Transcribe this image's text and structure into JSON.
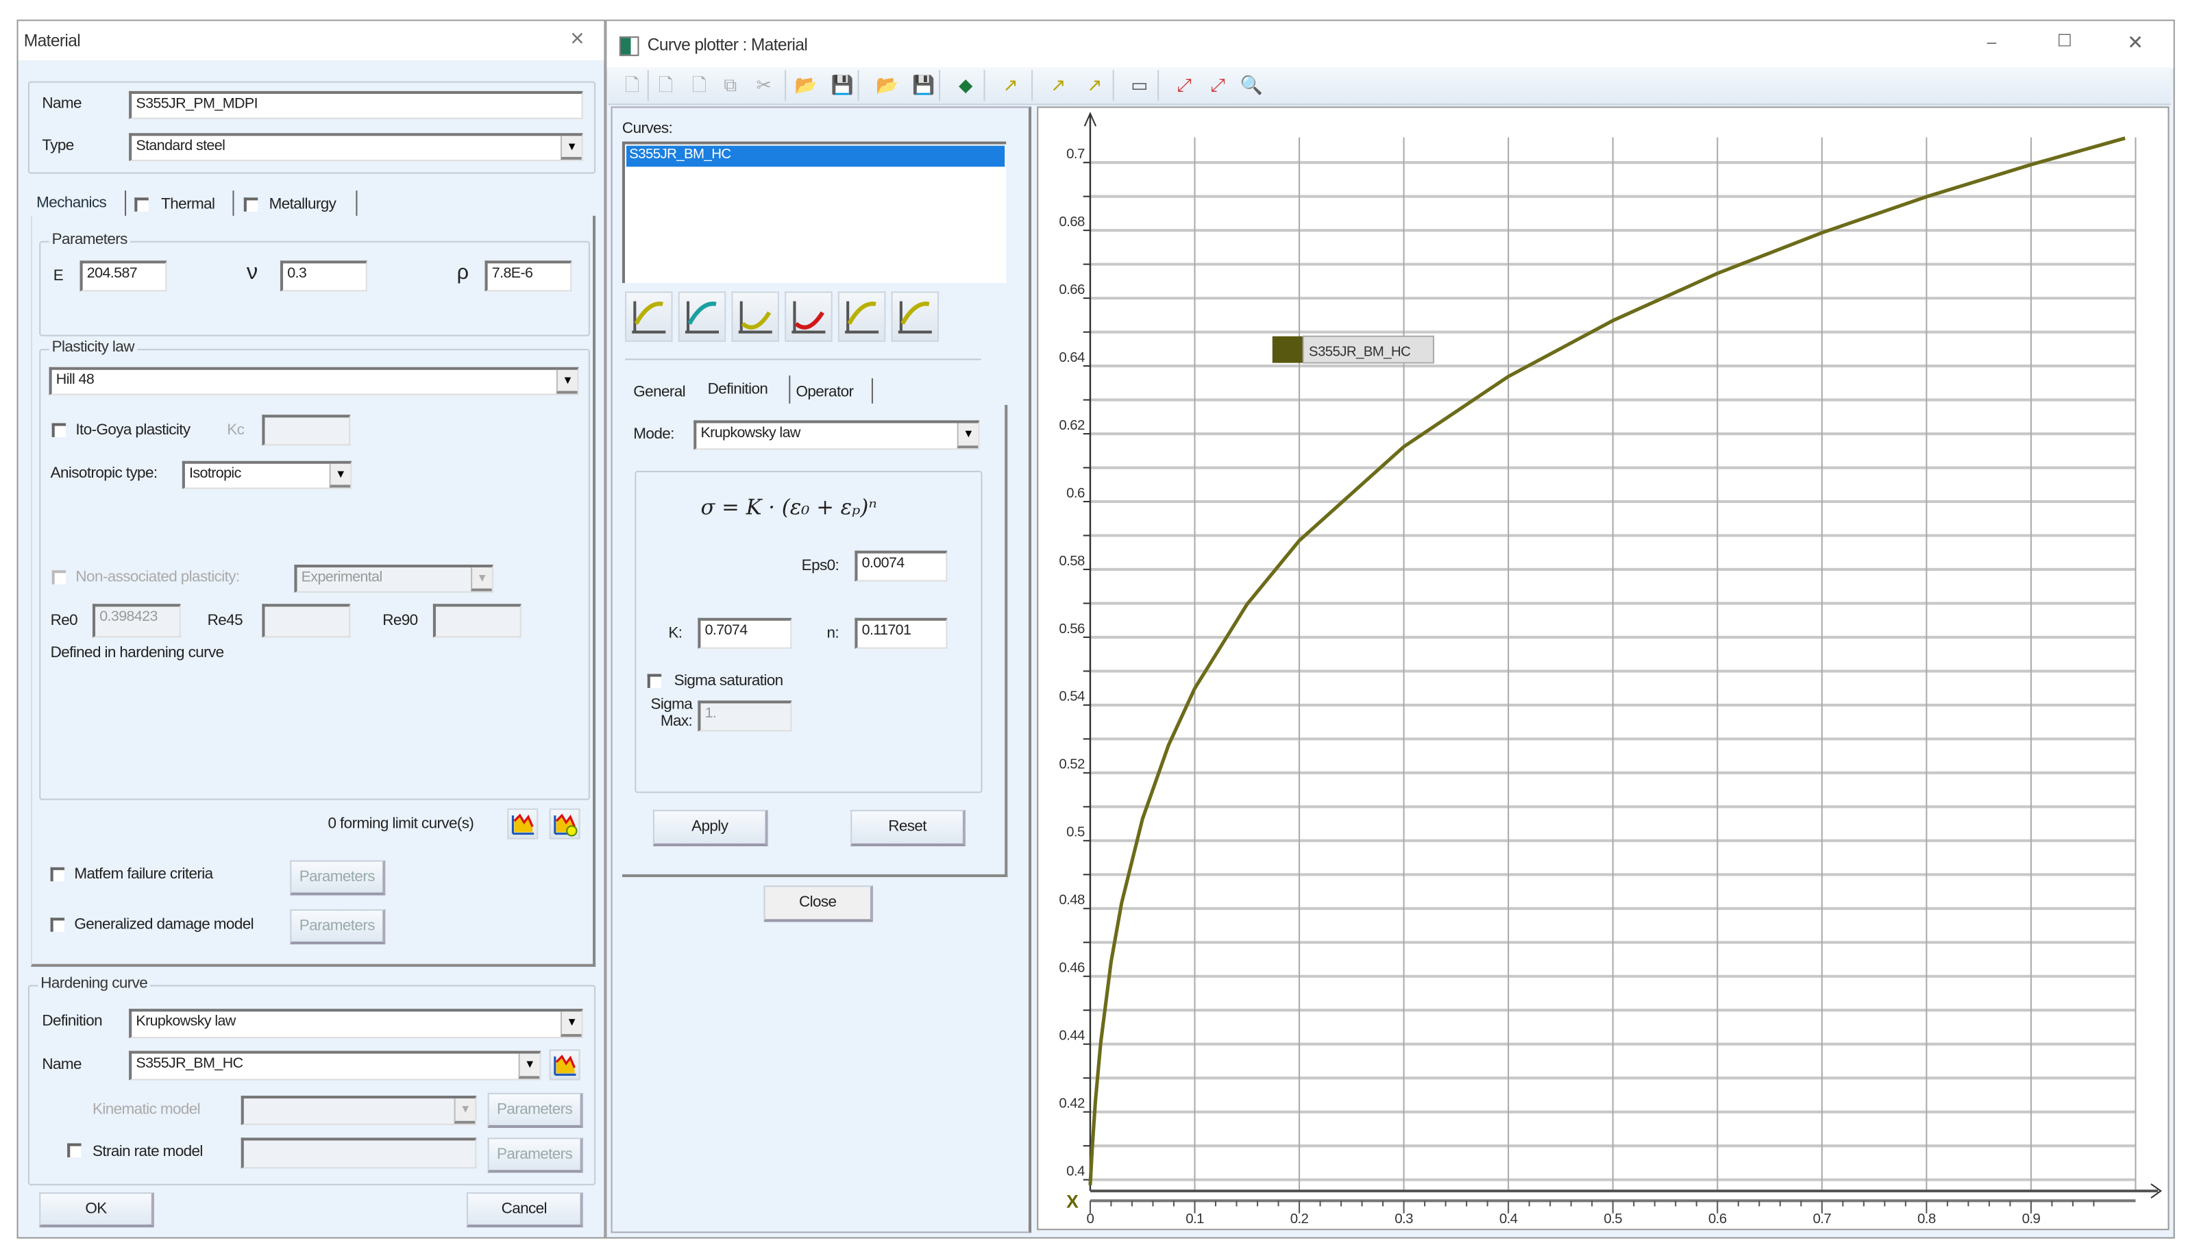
{
  "material": {
    "title": "Material",
    "close_icon": "×",
    "name_label": "Name",
    "name_value": "S355JR_PM_MDPI",
    "type_label": "Type",
    "type_value": "Standard steel",
    "tabs": [
      "Mechanics",
      "Thermal",
      "Metallurgy"
    ],
    "parameters": {
      "legend": "Parameters",
      "e_label": "E",
      "e_value": "204.587",
      "nu_label": "ν",
      "nu_value": "0.3",
      "rho_label": "ρ",
      "rho_value": "7.8E-6"
    },
    "plasticity": {
      "legend": "Plasticity law",
      "law_value": "Hill 48",
      "ito_goya_label": "Ito-Goya plasticity",
      "kc_label": "Kc",
      "anisotropic_label": "Anisotropic type:",
      "anisotropic_value": "Isotropic",
      "non_assoc_label": "Non-associated plasticity:",
      "non_assoc_value": "Experimental",
      "re0_label": "Re0",
      "re0_value": "0.398423",
      "re45_label": "Re45",
      "re90_label": "Re90",
      "defined_note": "Defined in hardening curve"
    },
    "forming_limit_label": "0 forming limit curve(s)",
    "matfem_label": "Matfem failure criteria",
    "damage_label": "Generalized damage model",
    "parameters_button": "Parameters",
    "hardening": {
      "legend": "Hardening curve",
      "definition_label": "Definition",
      "definition_value": "Krupkowsky law",
      "name_label": "Name",
      "name_value": "S355JR_BM_HC",
      "kinematic_label": "Kinematic model",
      "strain_rate_label": "Strain rate model"
    },
    "ok_button": "OK",
    "cancel_button": "Cancel"
  },
  "plotter": {
    "title": "Curve plotter : Material",
    "window_controls": [
      "–",
      "☐",
      "✕"
    ],
    "toolbar_icons": [
      "new-curve-icon",
      "import-curve-icon",
      "export-curve-icon",
      "copy-curve-icon",
      "delete-curve-icon",
      "open-folder-icon",
      "save-icon",
      "open-project-icon",
      "save-as-icon",
      "color-icon",
      "add-point-icon",
      "move-point-icon",
      "remove-point-icon",
      "layout-icon",
      "zoom-region-icon",
      "zoom-fit-icon",
      "zoom-icon"
    ],
    "curves_label": "Curves:",
    "curves": [
      "S355JR_BM_HC"
    ],
    "curve_tool_icons": [
      "load-curve-icon",
      "fit-curve-icon",
      "yield-icon",
      "reverse-yield-icon",
      "spline-curve-icon",
      "time-curve-icon"
    ],
    "tabs": [
      "General",
      "Definition",
      "Operator"
    ],
    "mode_label": "Mode:",
    "mode_value": "Krupkowsky law",
    "formula": "σ = K · (ε₀ + εₚ)ⁿ",
    "eps0_label": "Eps0:",
    "eps0_value": "0.0074",
    "k_label": "K:",
    "k_value": "0.7074",
    "n_label": "n:",
    "n_value": "0.11701",
    "sigma_sat_label": "Sigma saturation",
    "sigma_max_label": "Sigma Max:",
    "sigma_max_value": "1.",
    "apply_button": "Apply",
    "reset_button": "Reset",
    "close_button": "Close"
  },
  "chart_data": {
    "type": "line",
    "title": "",
    "xlabel": "",
    "ylabel": "",
    "xlim": [
      0,
      1.0
    ],
    "ylim": [
      0.4,
      0.7
    ],
    "x_ticks": [
      "0",
      "0.1",
      "0.2",
      "0.3",
      "0.4",
      "0.5",
      "0.6",
      "0.7",
      "0.8",
      "0.9"
    ],
    "y_ticks": [
      "0.4",
      "0.42",
      "0.44",
      "0.46",
      "0.48",
      "0.5",
      "0.52",
      "0.54",
      "0.56",
      "0.58",
      "0.6",
      "0.62",
      "0.64",
      "0.66",
      "0.68",
      "0.7"
    ],
    "x_axis_marker": "X",
    "grid": true,
    "legend_position": "upper-left",
    "series": [
      {
        "name": "S355JR_BM_HC",
        "color": "#6b6b1a",
        "x": [
          0,
          0.002,
          0.005,
          0.01,
          0.02,
          0.03,
          0.05,
          0.075,
          0.1,
          0.15,
          0.2,
          0.3,
          0.4,
          0.5,
          0.6,
          0.7,
          0.8,
          0.9,
          0.99
        ],
        "y": [
          0.3984,
          0.4097,
          0.4232,
          0.4404,
          0.4643,
          0.4816,
          0.5064,
          0.5282,
          0.5449,
          0.5697,
          0.5885,
          0.6162,
          0.6369,
          0.6534,
          0.6673,
          0.6793,
          0.6899,
          0.6994,
          0.7072
        ]
      }
    ]
  }
}
